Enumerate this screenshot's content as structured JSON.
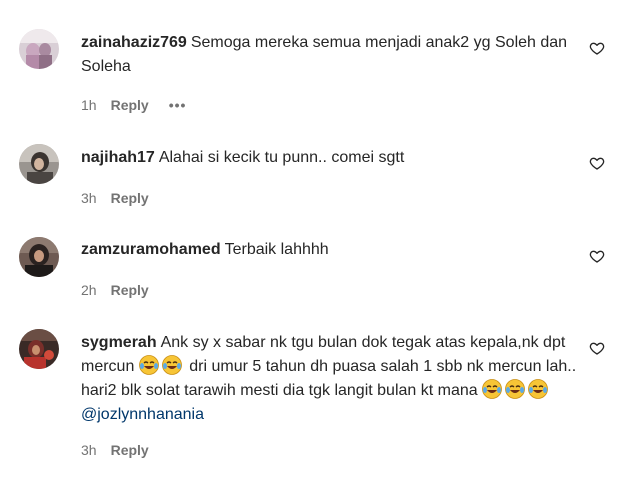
{
  "comments": [
    {
      "username": "zainahaziz769",
      "text": "Semoga mereka semua menjadi anak2 yg Soleh dan Soleha",
      "time": "1h",
      "reply_label": "Reply",
      "more_label": "•••"
    },
    {
      "username": "najihah17",
      "text": "Alahai si kecik tu punn.. comei sgtt",
      "time": "3h",
      "reply_label": "Reply"
    },
    {
      "username": "zamzuramohamed",
      "text": "Terbaik lahhhh",
      "time": "2h",
      "reply_label": "Reply"
    },
    {
      "username": "sygmerah",
      "text_part1": "Ank sy x sabar nk tgu bulan dok tegak atas kepala,nk dpt mercun",
      "text_part2": "dri umur 5 tahun dh puasa salah 1 sbb nk mercun lah.. hari2 blk solat tarawih mesti dia tgk langit bulan kt mana",
      "mention": "@jozlynnhanania",
      "time": "3h",
      "reply_label": "Reply"
    }
  ],
  "icons": {
    "heart": "heart-outline-icon",
    "emoji": "face-with-tears-of-joy-emoji"
  },
  "colors": {
    "text": "#262626",
    "secondary": "#737373",
    "mention": "#00376b"
  }
}
